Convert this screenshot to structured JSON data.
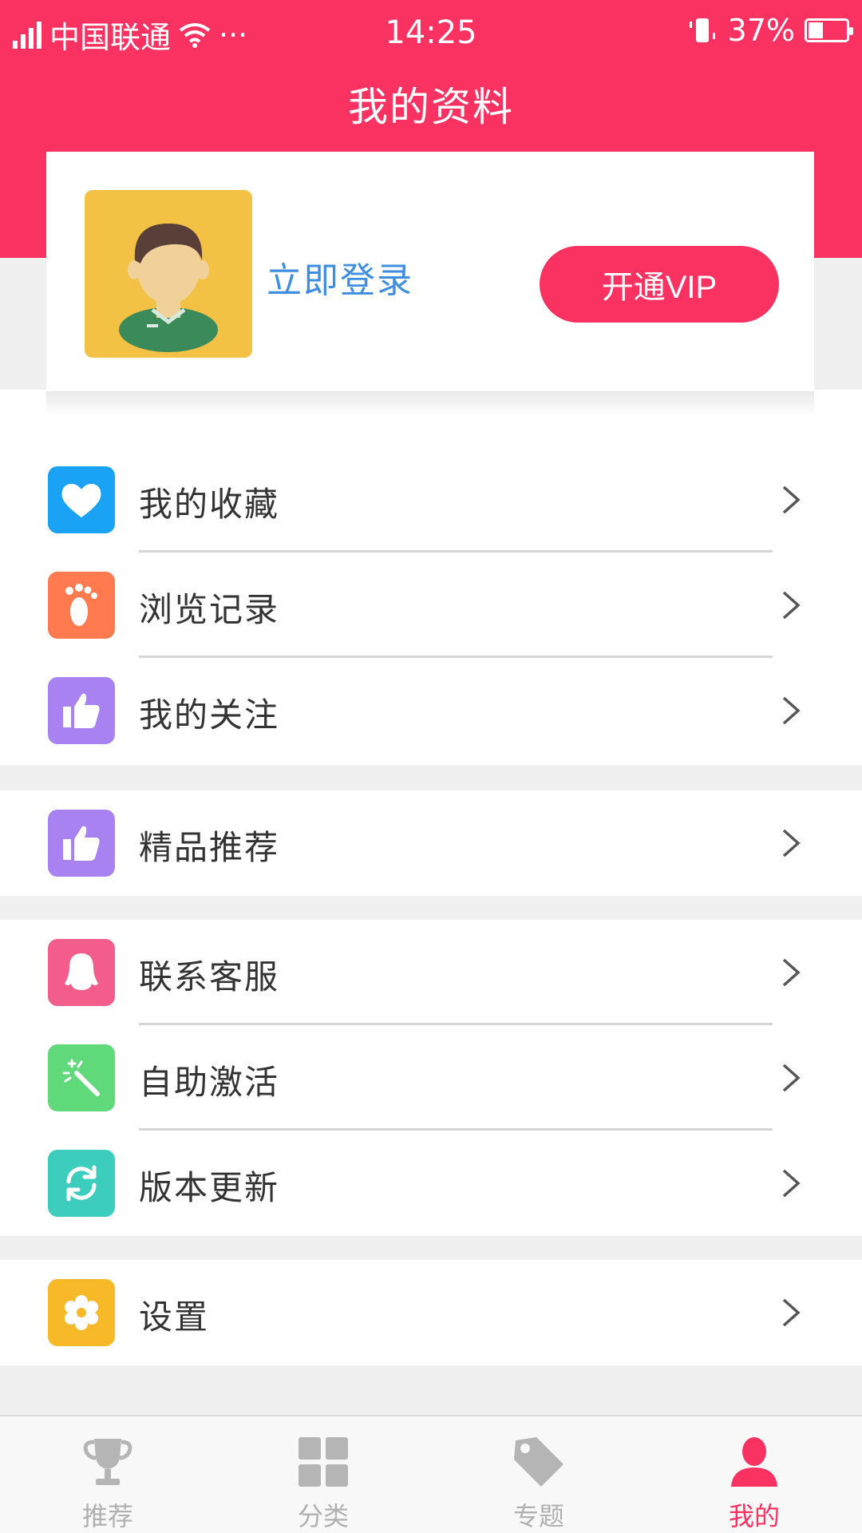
{
  "status_bar": {
    "carrier": "中国联通",
    "more": "···",
    "time": "14:25",
    "battery": "37%",
    "battery_level": 0.37,
    "icons": [
      "signal-icon",
      "wifi-icon",
      "vibrate-icon",
      "battery-icon"
    ]
  },
  "header": {
    "title": "我的资料"
  },
  "profile": {
    "login_text": "立即登录",
    "vip_button": "开通VIP",
    "avatar_icon": "user-avatar-icon"
  },
  "colors": {
    "brand": "#fa3262",
    "link": "#3d8de0",
    "favorites": "#1aa3f5",
    "history": "#ff7a4e",
    "follow": "#a782f0",
    "recommend": "#a782f0",
    "support": "#f25d8b",
    "activate": "#5fd97a",
    "update": "#3ccdbd",
    "settings": "#f7b927"
  },
  "menu_groups": [
    {
      "items": [
        {
          "label": "我的收藏",
          "icon": "heart-icon"
        },
        {
          "label": "浏览记录",
          "icon": "footprint-icon"
        },
        {
          "label": "我的关注",
          "icon": "thumbs-up-icon"
        }
      ]
    },
    {
      "items": [
        {
          "label": "精品推荐",
          "icon": "thumbs-up-icon"
        }
      ]
    },
    {
      "items": [
        {
          "label": "联系客服",
          "icon": "qq-icon"
        },
        {
          "label": "自助激活",
          "icon": "magic-wand-icon"
        },
        {
          "label": "版本更新",
          "icon": "refresh-icon"
        }
      ]
    },
    {
      "items": [
        {
          "label": "设置",
          "icon": "gear-icon"
        }
      ]
    }
  ],
  "tabs": [
    {
      "label": "推荐",
      "icon": "trophy-icon",
      "active": false
    },
    {
      "label": "分类",
      "icon": "grid-icon",
      "active": false
    },
    {
      "label": "专题",
      "icon": "tag-icon",
      "active": false
    },
    {
      "label": "我的",
      "icon": "person-icon",
      "active": true
    }
  ]
}
